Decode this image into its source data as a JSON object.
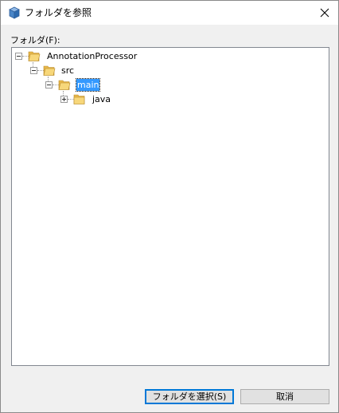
{
  "window": {
    "title": "フォルダを参照",
    "close_glyph": "✕"
  },
  "folder_field_label": "フォルダ(F):",
  "tree": {
    "nodes": [
      {
        "label": "AnnotationProcessor",
        "expanded": true,
        "selected": false
      },
      {
        "label": "src",
        "expanded": true,
        "selected": false
      },
      {
        "label": "main",
        "expanded": true,
        "selected": true
      },
      {
        "label": "java",
        "expanded": false,
        "selected": false
      }
    ]
  },
  "buttons": {
    "select_label": "フォルダを選択(S)",
    "cancel_label": "取消"
  },
  "colors": {
    "selection": "#3399ff",
    "folder": "#f5d06b",
    "default_button_border": "#0078d7"
  }
}
